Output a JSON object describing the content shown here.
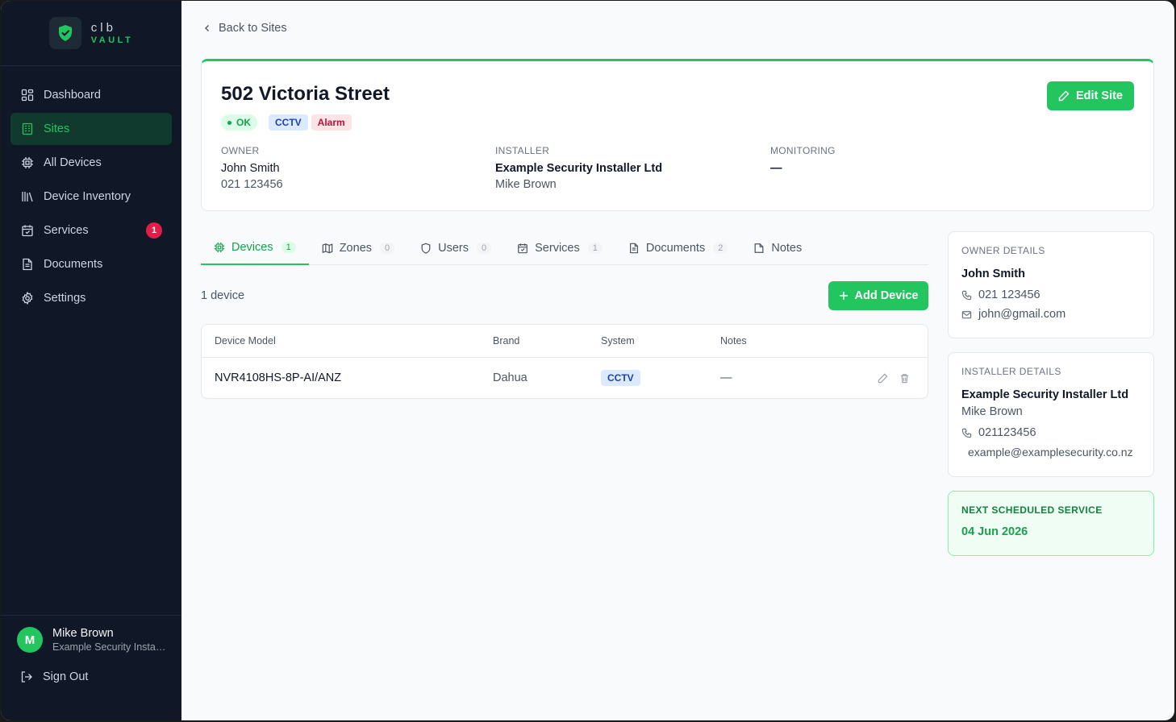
{
  "brand": {
    "top": "clb",
    "bottom": "VAULT"
  },
  "nav": {
    "dashboard": "Dashboard",
    "sites": "Sites",
    "all_devices": "All Devices",
    "device_inventory": "Device Inventory",
    "services": "Services",
    "services_badge": "1",
    "documents": "Documents",
    "settings": "Settings"
  },
  "user": {
    "initial": "M",
    "name": "Mike Brown",
    "org": "Example Security Installer Ltd",
    "sign_out": "Sign Out"
  },
  "back_link": "Back to Sites",
  "site": {
    "title": "502 Victoria Street",
    "status": "OK",
    "tags": [
      "CCTV",
      "Alarm"
    ],
    "edit_label": "Edit Site",
    "owner_label": "OWNER",
    "owner_name": "John Smith",
    "owner_phone": "021 123456",
    "installer_label": "INSTALLER",
    "installer_name": "Example Security Installer Ltd",
    "installer_contact": "Mike Brown",
    "monitoring_label": "MONITORING",
    "monitoring_value": "—"
  },
  "tabs": [
    {
      "label": "Devices",
      "count": "1"
    },
    {
      "label": "Zones",
      "count": "0"
    },
    {
      "label": "Users",
      "count": "0"
    },
    {
      "label": "Services",
      "count": "1"
    },
    {
      "label": "Documents",
      "count": "2"
    },
    {
      "label": "Notes",
      "count": ""
    }
  ],
  "devices": {
    "count_text": "1 device",
    "add_label": "Add Device",
    "columns": [
      "Device Model",
      "Brand",
      "System",
      "Notes"
    ],
    "rows": [
      {
        "model": "NVR4108HS-8P-AI/ANZ",
        "brand": "Dahua",
        "system": "CCTV",
        "notes": "—"
      }
    ]
  },
  "owner_details": {
    "label": "OWNER DETAILS",
    "name": "John Smith",
    "phone": "021 123456",
    "email": "john@gmail.com"
  },
  "installer_details": {
    "label": "INSTALLER DETAILS",
    "name": "Example Security Installer Ltd",
    "contact": "Mike Brown",
    "phone": "021123456",
    "email": "example@examplesecurity.co.nz"
  },
  "next_service": {
    "label": "NEXT SCHEDULED SERVICE",
    "date": "04 Jun 2026"
  },
  "colors": {
    "accent": "#22c55e",
    "sidebar": "#101727",
    "danger": "#e11d48"
  }
}
